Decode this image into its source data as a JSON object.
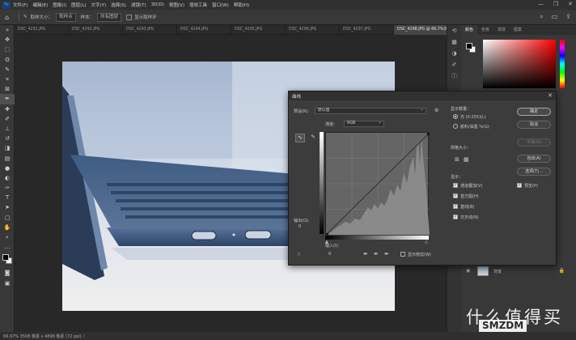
{
  "menubar": {
    "logo": "Ps",
    "items": [
      "文件(F)",
      "编辑(E)",
      "图像(I)",
      "图层(L)",
      "文字(Y)",
      "选择(S)",
      "滤镜(T)",
      "3D(D)",
      "视图(V)",
      "增效工具",
      "窗口(W)",
      "帮助(H)"
    ],
    "window_controls": [
      "—",
      "❐",
      "✕"
    ]
  },
  "options": {
    "sample_size_label": "取样大小：",
    "sample_size_value": "取样点",
    "sample_label": "样本：",
    "sample_value": "所有图层",
    "show_ring_label": "显示取样环"
  },
  "tabs": [
    {
      "label": "DSC_4291.JPG",
      "active": false
    },
    {
      "label": "DSC_4292.JPG",
      "active": false
    },
    {
      "label": "DSC_4293.JPG",
      "active": false
    },
    {
      "label": "DSC_4294.JPG",
      "active": false
    },
    {
      "label": "DSC_4295.JPG",
      "active": false
    },
    {
      "label": "DSC_4296.JPG",
      "active": false
    },
    {
      "label": "DSC_4297.JPG",
      "active": false
    },
    {
      "label": "DSC_4298.JPG @ 66.7%(RGB/8)",
      "active": true
    }
  ],
  "tabs_more": "»",
  "status": {
    "text": "66.67%   3508 像素 x 4898 像素 (72 ppi)   〉"
  },
  "panel": {
    "tabs": [
      "颜色",
      "色板",
      "渐变",
      "图案"
    ],
    "layer_name": "背景"
  },
  "curves": {
    "title": "曲线",
    "preset_label": "预设(R):",
    "preset_value": "默认值",
    "channel_label": "通道：",
    "channel_value": "RGB",
    "output_label": "输出(O):",
    "output_value": "0",
    "input_label": "输入(I):",
    "input_value": "0",
    "show_clipping": "显示修剪(W)",
    "display_label": "显示数量：",
    "light_option": "光 (0-255)(L)",
    "pigment_option": "颜料/油墨 %(G)",
    "grid_label": "网格大小：",
    "show_label": "显示：",
    "show_options": [
      "通道叠加(V)",
      "直方图(H)",
      "基线(B)",
      "交叉线(N)"
    ],
    "buttons": {
      "ok": "确定",
      "cancel": "取消",
      "smooth": "平滑(M)",
      "auto": "自动(A)",
      "options": "选项(T)..."
    },
    "preview_label": "预览(P)"
  },
  "watermark": {
    "text_cn": "什么值得买",
    "text_en": "SMZDM"
  }
}
